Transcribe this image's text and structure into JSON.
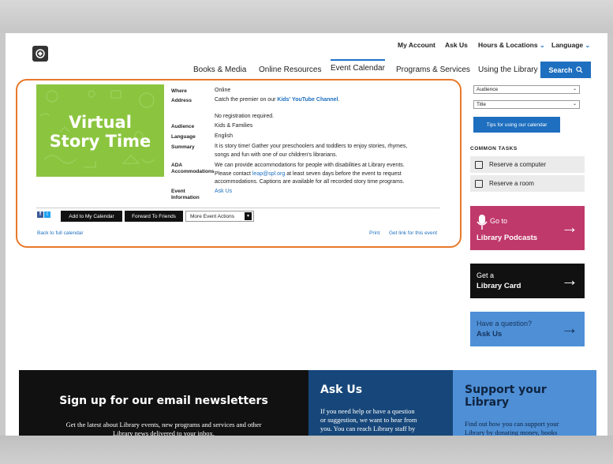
{
  "header": {
    "utility": [
      {
        "label": "My Account"
      },
      {
        "label": "Ask Us"
      },
      {
        "label": "Hours & Locations"
      },
      {
        "label": "Language"
      }
    ],
    "nav": [
      "Books & Media",
      "Online Resources",
      "Event Calendar",
      "Programs & Services",
      "Using the Library"
    ],
    "active_nav": "Event Calendar",
    "search_label": "Search"
  },
  "event": {
    "image_title_line1": "Virtual",
    "image_title_line2": "Story Time",
    "where_label": "Where",
    "where_value": "Online",
    "address_label": "Address",
    "address_prefix": "Catch the premier on our",
    "address_link": "Kids' YouTube Channel",
    "registration": "No registration required.",
    "audience_label": "Audience",
    "audience_value": "Kids & Families",
    "language_label": "Language",
    "language_value": "English",
    "summary_label": "Summary",
    "summary_value_1": "It is story time! Gather your preschoolers and toddlers to enjoy stories, rhymes,",
    "summary_value_2": "songs and fun with one of our children's librarians.",
    "ada_label_1": "ADA",
    "ada_label_2": "Accommodations",
    "ada_value_1": "We can provide accommodations for people with disabilities at Library events.",
    "ada_value_2a": "Please contact",
    "ada_email": "leap@spl.org",
    "ada_value_2b": "at least seven days before the event to request",
    "ada_value_3": "accommodations. Captions are available for all recorded story time programs.",
    "info_label_1": "Event",
    "info_label_2": "Information",
    "info_link": "Ask Us",
    "buttons": {
      "add_calendar": "Add to My Calendar",
      "forward": "Forward To Friends",
      "more": "More Event Actions"
    },
    "back_link": "Back to full calendar",
    "print_link": "Print",
    "get_link": "Get link for this event"
  },
  "sidebar": {
    "audience_select": "Audience",
    "title_select": "Title",
    "tips_button": "Tips for using our calendar",
    "common_tasks_heading": "COMMON TASKS",
    "tasks": [
      "Reserve a computer",
      "Reserve a room"
    ],
    "promos": [
      {
        "line1": "Go to",
        "line2": "Library Podcasts",
        "color": "#c0396b"
      },
      {
        "line1": "Get a",
        "line2": "Library Card",
        "color": "#111111"
      },
      {
        "line1": "Have a question?",
        "line2": "Ask Us",
        "color": "#4e8fd6"
      }
    ]
  },
  "footer": {
    "newsletter_heading": "Sign up for our email newsletters",
    "newsletter_text_1": "Get the latest about Library events, new programs and services and other",
    "newsletter_text_2": "Library news delivered to your inbox.",
    "askus_heading": "Ask Us",
    "askus_text_1": "If you need help or have a question",
    "askus_text_2": "or suggestion, we want to hear from",
    "askus_text_3": "you. You can reach Library staff by",
    "support_heading_1": "Support your",
    "support_heading_2": "Library",
    "support_text_1": "Find out how you can support your",
    "support_text_2": "Library by donating money, books"
  },
  "colors": {
    "accent": "#1e6fbf",
    "highlight": "#e8792b",
    "event_image": "#8bc53f"
  }
}
